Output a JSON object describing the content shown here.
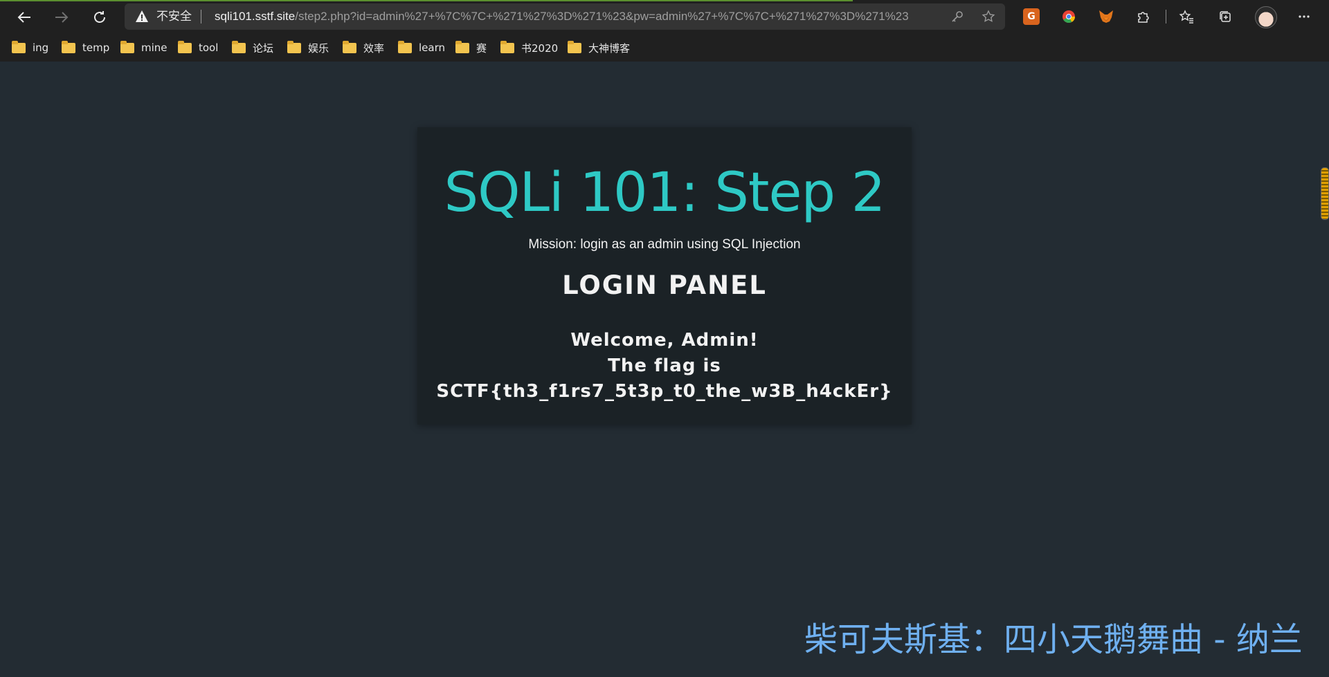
{
  "browser": {
    "security_label": "不安全",
    "url_host": "sqli101.sstf.site",
    "url_path": "/step2.php?id=admin%27+%7C%7C+%271%27%3D%271%23&pw=admin%27+%7C%7C+%271%27%3D%271%23",
    "icons": [
      "back-arrow-icon",
      "forward-arrow-icon",
      "refresh-icon",
      "warning-icon",
      "key-icon",
      "add-favorite-icon",
      "translate-extension-icon",
      "chrome-extension-icon",
      "fox-extension-icon",
      "extensions-puzzle-icon",
      "favorites-icon",
      "collections-icon",
      "more-icon"
    ]
  },
  "bookmarks": [
    {
      "label": "ing"
    },
    {
      "label": "temp"
    },
    {
      "label": "mine"
    },
    {
      "label": "tool"
    },
    {
      "label": "论坛"
    },
    {
      "label": "娱乐"
    },
    {
      "label": "效率"
    },
    {
      "label": "learn"
    },
    {
      "label": "赛"
    },
    {
      "label": "书2020"
    },
    {
      "label": "大神博客"
    }
  ],
  "page": {
    "title": "SQLi 101: Step 2",
    "mission": "Mission: login as an admin using SQL Injection",
    "panel_heading": "LOGIN PANEL",
    "welcome": "Welcome, Admin!",
    "flag_intro": "The flag is",
    "flag": "SCTF{th3_f1rs7_5t3p_t0_the_w3B_h4ckEr}"
  },
  "overlay": {
    "caption": "柴可夫斯基：四小天鹅舞曲 - 纳兰"
  },
  "colors": {
    "page_bg": "#232c33",
    "card_bg": "#1b2226",
    "title": "#2ec9c5",
    "caption": "#6fb0f0"
  }
}
